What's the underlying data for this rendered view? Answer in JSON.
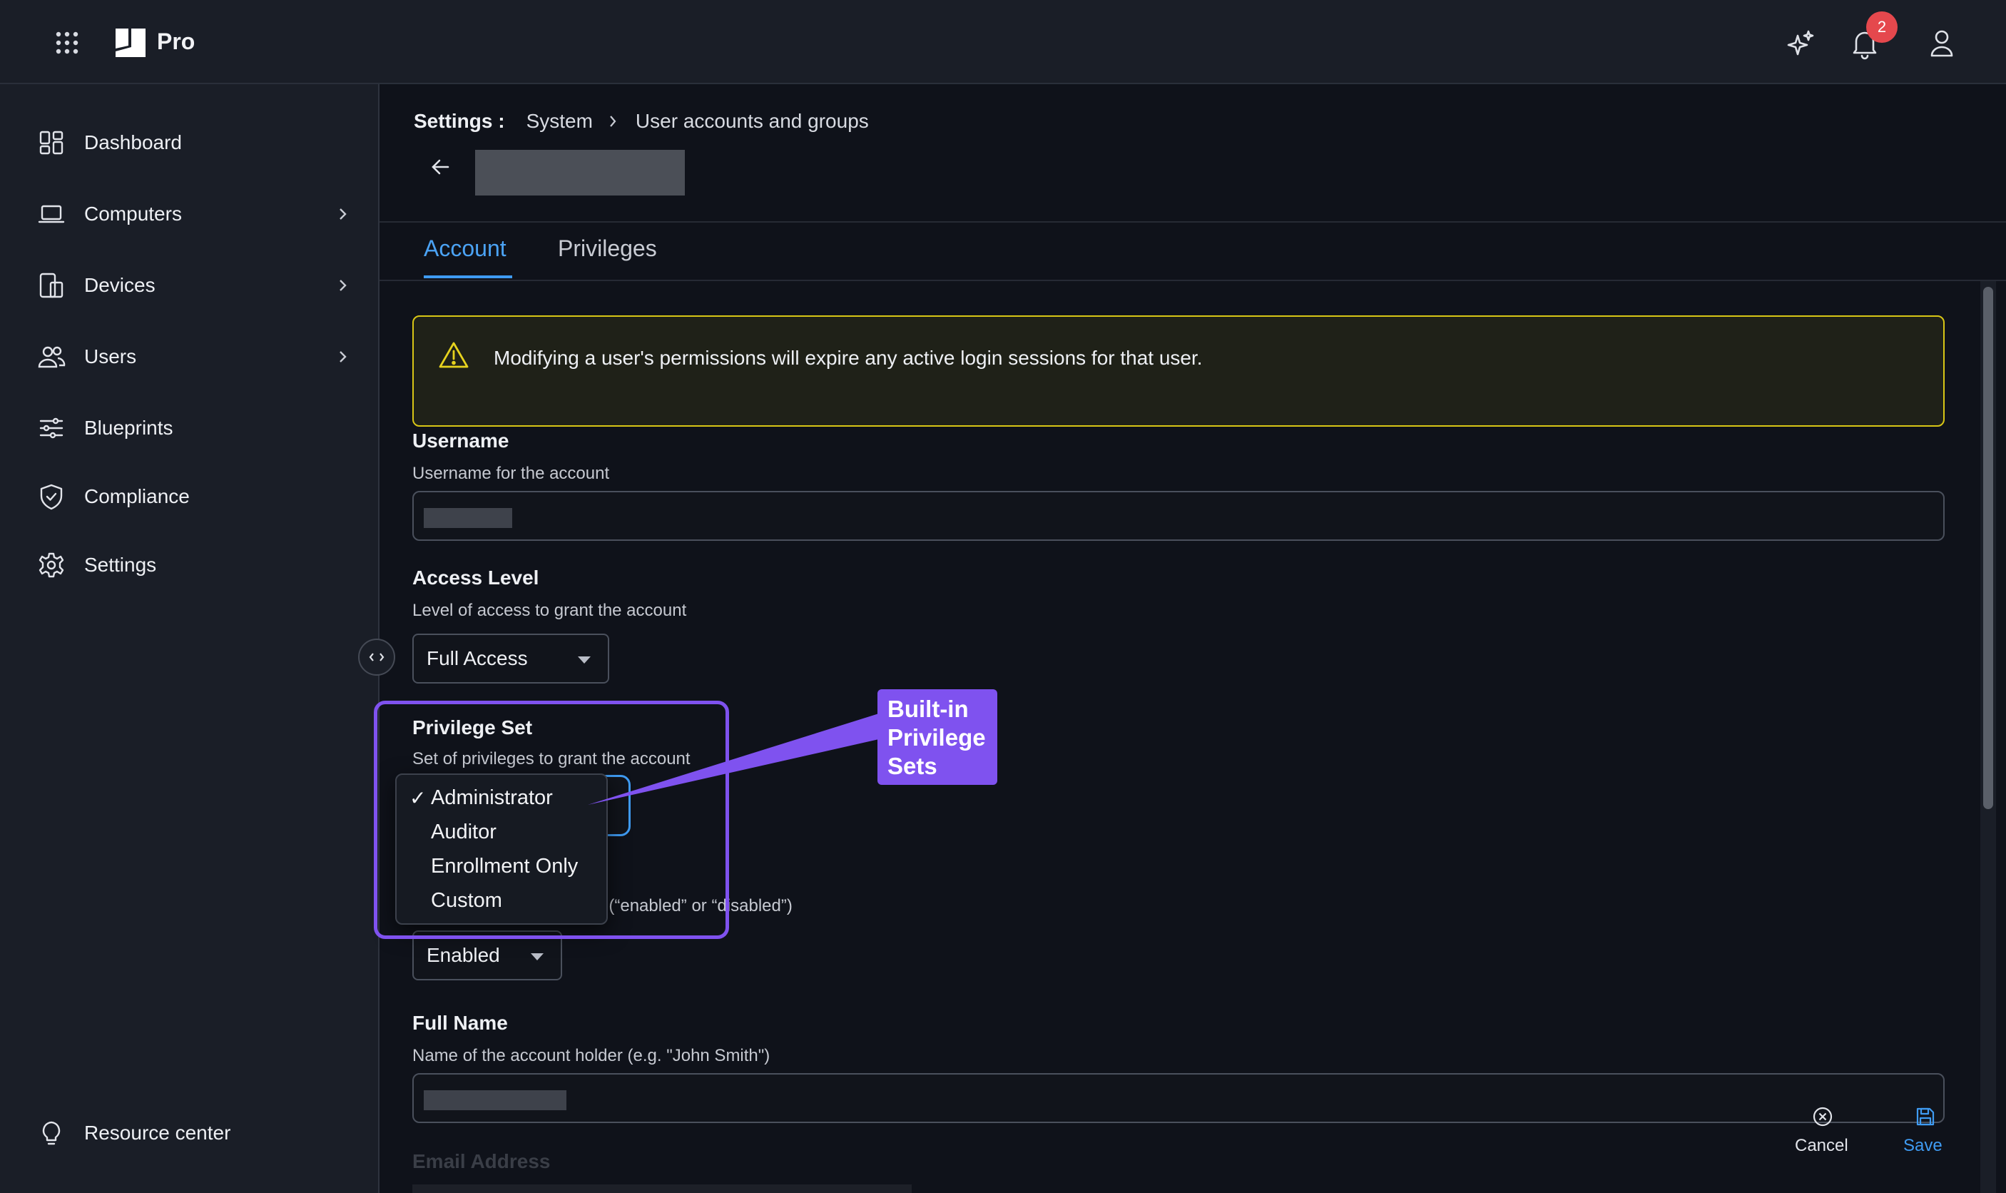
{
  "app": {
    "name": "Pro",
    "notification_count": "2"
  },
  "sidebar": {
    "items": [
      {
        "label": "Dashboard",
        "icon": "dashboard-icon"
      },
      {
        "label": "Computers",
        "icon": "laptop-icon",
        "has_children": true
      },
      {
        "label": "Devices",
        "icon": "devices-icon",
        "has_children": true
      },
      {
        "label": "Users",
        "icon": "users-icon",
        "has_children": true
      },
      {
        "label": "Blueprints",
        "icon": "sliders-icon"
      },
      {
        "label": "Compliance",
        "icon": "shield-icon"
      },
      {
        "label": "Settings",
        "icon": "gear-icon"
      }
    ],
    "footer_label": "Resource center"
  },
  "breadcrumb": {
    "root": "Settings :",
    "section": "System",
    "page": "User accounts and groups"
  },
  "tabs": [
    {
      "label": "Account",
      "active": true
    },
    {
      "label": "Privileges",
      "active": false
    }
  ],
  "alert": {
    "message": "Modifying a user's permissions will expire any active login sessions for that user."
  },
  "form": {
    "username": {
      "title": "Username",
      "subtitle": "Username for the account"
    },
    "access_level": {
      "title": "Access Level",
      "subtitle": "Level of access to grant the account",
      "value": "Full Access"
    },
    "privilege_set": {
      "title": "Privilege Set",
      "subtitle": "Set of privileges to grant the account",
      "options": [
        "Administrator",
        "Auditor",
        "Enrollment Only",
        "Custom"
      ],
      "selected": "Administrator",
      "check_mark": "✓"
    },
    "status": {
      "subtitle_tail": "ount (“enabled” or “disabled”)",
      "value": "Enabled"
    },
    "full_name": {
      "title": "Full Name",
      "subtitle": "Name of the account holder (e.g. \"John Smith\")"
    },
    "email": {
      "title": "Email Address"
    }
  },
  "actions": {
    "cancel": "Cancel",
    "save": "Save"
  },
  "callout": {
    "line1": "Built-in",
    "line2": "Privilege",
    "line3": "Sets"
  },
  "colors": {
    "accent": "#3f9bf2",
    "warning": "#e6d21e",
    "callout": "#7f52ef",
    "badge": "#e5484d"
  }
}
